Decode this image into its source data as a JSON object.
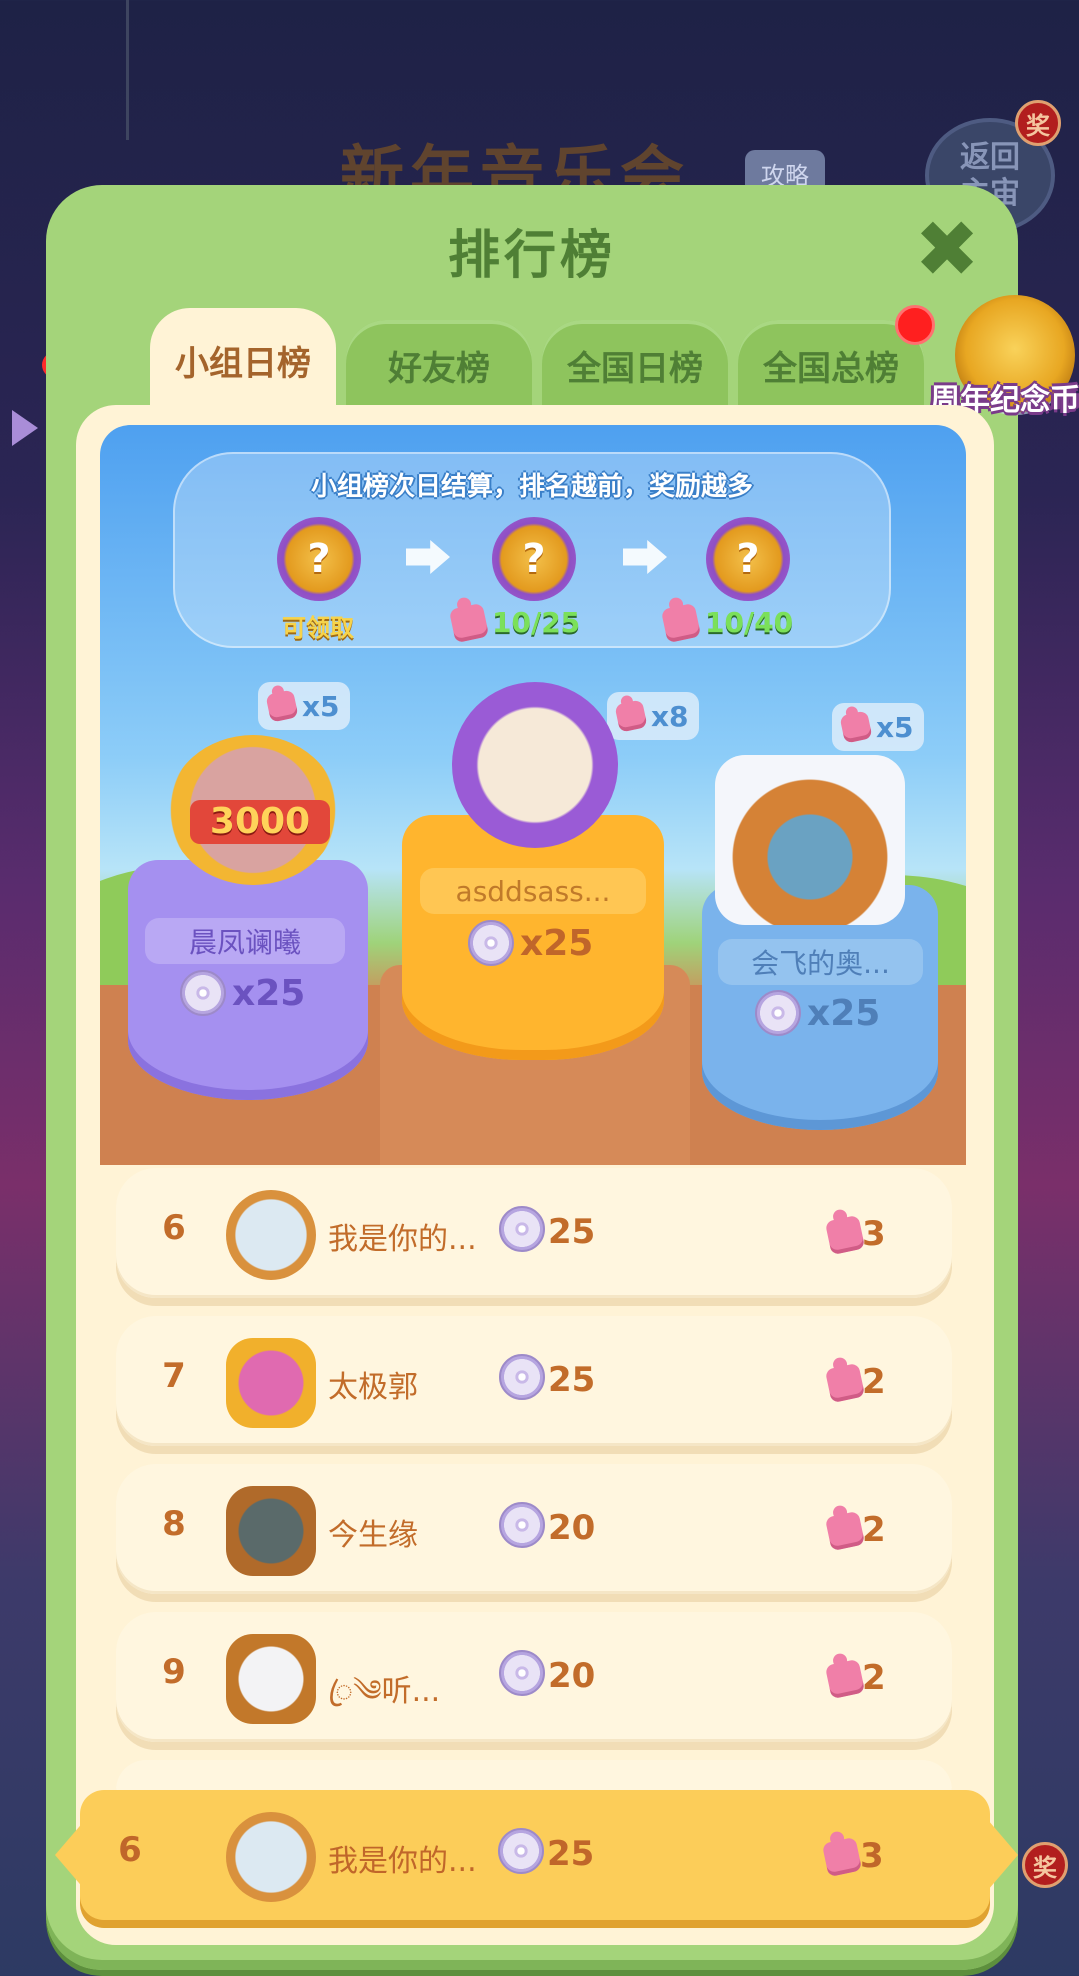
{
  "background": {
    "event_title": "新年音乐会",
    "guide_label": "攻略",
    "back_label": "返回\n主宙",
    "badge_label": "奖"
  },
  "panel": {
    "title": "排行榜",
    "close_icon": "✖",
    "tabs": [
      {
        "label": "小组日榜",
        "active": true
      },
      {
        "label": "好友榜",
        "active": false
      },
      {
        "label": "全国日榜",
        "active": false
      },
      {
        "label": "全国总榜",
        "active": false
      }
    ],
    "coin_badge_label": "周年纪念币"
  },
  "reward_track": {
    "title": "小组榜次日结算，排名越前，奖励越多",
    "gifts": [
      {
        "symbol": "?",
        "status": "可领取"
      },
      {
        "symbol": "?",
        "progress": "10/25"
      },
      {
        "symbol": "?",
        "progress": "10/40"
      }
    ]
  },
  "podium": [
    {
      "place": 2,
      "name": "晨凤谰曦",
      "reward": "x25",
      "puzzle_bonus": "x5",
      "frame_label": "3000",
      "color": "#a590f0"
    },
    {
      "place": 1,
      "name": "asddsass...",
      "reward": "x25",
      "puzzle_bonus": "x8",
      "color": "#ffb52e"
    },
    {
      "place": 3,
      "name": "会飞的奥...",
      "reward": "x25",
      "puzzle_bonus": "x5",
      "color": "#7ab3ec"
    }
  ],
  "rows": [
    {
      "rank": "6",
      "name": "我是你的...",
      "score": "25",
      "pieces": "3"
    },
    {
      "rank": "7",
      "name": "太极郭",
      "score": "25",
      "pieces": "2"
    },
    {
      "rank": "8",
      "name": "今生缘",
      "score": "20",
      "pieces": "2"
    },
    {
      "rank": "9",
      "name": "ꦿ༄听...",
      "score": "20",
      "pieces": "2"
    }
  ],
  "my_row": {
    "rank": "6",
    "name": "我是你的...",
    "score": "25",
    "pieces": "3"
  },
  "colors": {
    "panel_green": "#a4d47a",
    "tab_text_green": "#4f7f35",
    "cream": "#fff3d6",
    "row_text": "#c26c2a",
    "my_row_bg": "#fccd59"
  }
}
